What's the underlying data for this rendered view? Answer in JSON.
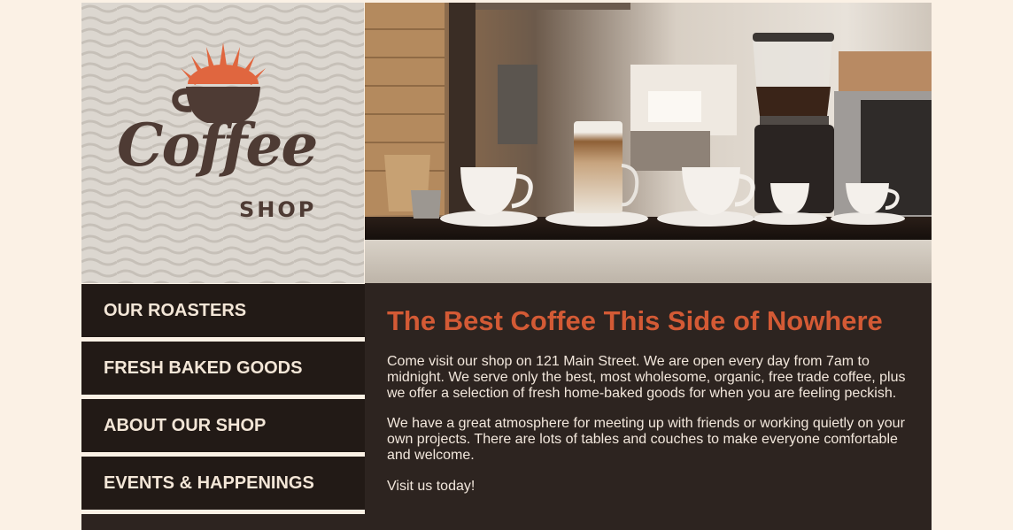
{
  "brand": {
    "logo_word": "Coffee",
    "logo_sub": "SHOP",
    "accent_color": "#d35a35",
    "dark_brown": "#4e3b34"
  },
  "hero": {
    "image_description_icon": "coffee-bar-photo"
  },
  "nav": {
    "items": [
      {
        "label": "OUR ROASTERS"
      },
      {
        "label": "FRESH BAKED GOODS"
      },
      {
        "label": "ABOUT OUR SHOP"
      },
      {
        "label": "EVENTS & HAPPENINGS"
      }
    ]
  },
  "main": {
    "heading": "The Best Coffee This Side of Nowhere",
    "paragraphs": [
      "Come visit our shop on 121 Main Street. We are open every day from 7am to midnight. We serve only the best, most wholesome, organic, free trade coffee, plus we offer a selection of fresh home-baked goods for when you are feeling peckish.",
      "We have a great atmosphere for meeting up with friends or working quietly on your own projects. There are lots of tables and couches to make everyone comfortable and welcome.",
      "Visit us today!"
    ]
  },
  "colors": {
    "page_bg": "#fbf1e5",
    "nav_bg": "#221a16",
    "content_bg": "#2d2420",
    "text_light": "#f2e7dc"
  }
}
